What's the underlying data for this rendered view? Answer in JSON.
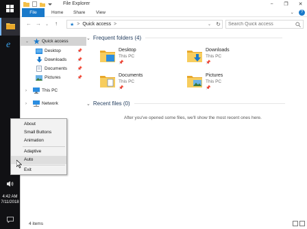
{
  "window": {
    "title": "File Explorer",
    "controls": [
      "−",
      "❐",
      "✕"
    ]
  },
  "ribbon": {
    "tabs": [
      "File",
      "Home",
      "Share",
      "View"
    ],
    "active_tab": "File",
    "accent": "#1979ca"
  },
  "navigation": {
    "address": "Quick access",
    "address_separator": ">",
    "search_placeholder": "Search Quick access"
  },
  "sidebar": {
    "quick_access": "Quick access",
    "items": [
      "Desktop",
      "Downloads",
      "Documents",
      "Pictures"
    ],
    "this_pc": "This PC",
    "network": "Network"
  },
  "main": {
    "frequent_header": "Frequent folders (4)",
    "recent_header": "Recent files (0)",
    "folders": [
      {
        "name": "Desktop",
        "location": "This PC",
        "icon": "desktop-folder-icon"
      },
      {
        "name": "Downloads",
        "location": "This PC",
        "icon": "downloads-folder-icon"
      },
      {
        "name": "Documents",
        "location": "This PC",
        "icon": "documents-folder-icon"
      },
      {
        "name": "Pictures",
        "location": "This PC",
        "icon": "pictures-folder-icon"
      }
    ],
    "empty_message": "After you've opened some files, we'll show the most recent ones here."
  },
  "status": {
    "item_count": "4 items"
  },
  "context_menu": {
    "items": [
      "About",
      "Small Buttons",
      "Animation",
      "Adaptive",
      "Auto",
      "Exit"
    ],
    "highlighted": "Auto"
  },
  "taskbar": {
    "time": "4:42 AM",
    "date": "7/11/2018"
  }
}
